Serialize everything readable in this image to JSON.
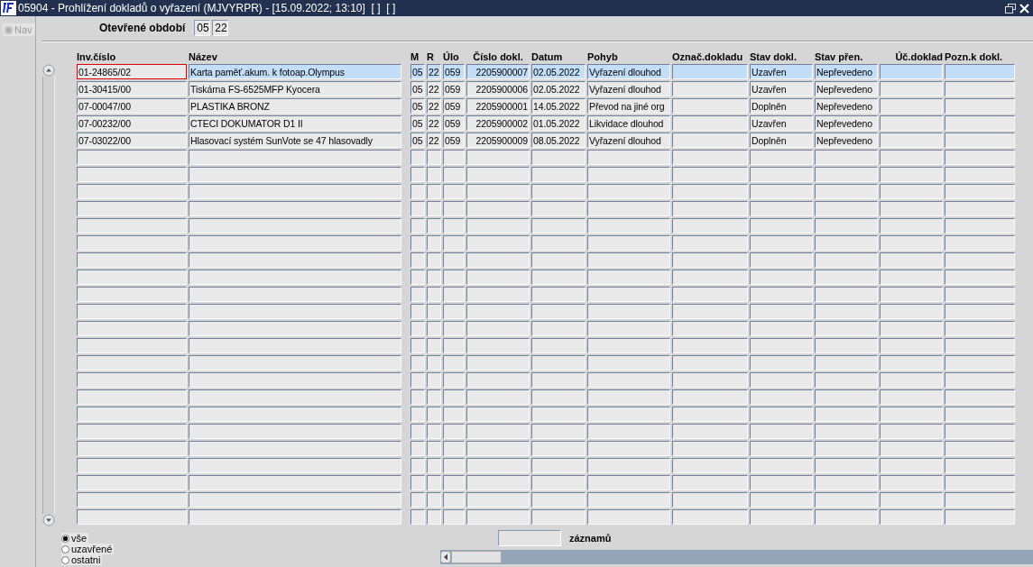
{
  "window": {
    "title": "05904 - Prohlížení dokladů o vyřazení (MJVYRPR) - [15.09.2022; 13:10]  [ ]  [ ]"
  },
  "nav": {
    "label": "Nav",
    "disabled": true
  },
  "period": {
    "label": "Otevřené období",
    "month": "05",
    "year": "22"
  },
  "table": {
    "columns": [
      "Inv.číslo",
      "Název",
      "M",
      "R",
      "Úlo",
      "Číslo dokl.",
      "Datum",
      "Pohyb",
      "Označ.dokladu",
      "Stav dokl.",
      "Stav přen.",
      "Úč.doklad",
      "Pozn.k dokl."
    ],
    "rows": [
      {
        "selected": true,
        "focused": true,
        "cells": [
          "01-24865/02",
          "Karta paměť.akum. k fotoap.Olympus",
          "05",
          "22",
          "059",
          "2205900007",
          "02.05.2022",
          "Vyřazení dlouhod",
          null,
          "Uzavřen",
          "Nepřevedeno",
          null,
          null
        ]
      },
      {
        "selected": false,
        "focused": false,
        "cells": [
          "01-30415/00",
          "Tiskárna FS-6525MFP Kyocera",
          "05",
          "22",
          "059",
          "2205900006",
          "02.05.2022",
          "Vyřazení dlouhod",
          null,
          "Uzavřen",
          "Nepřevedeno",
          null,
          null
        ]
      },
      {
        "selected": false,
        "focused": false,
        "cells": [
          "07-00047/00",
          "PLASTIKA BRONZ",
          "05",
          "22",
          "059",
          "2205900001",
          "14.05.2022",
          "Převod na jiné org",
          null,
          "Doplněn",
          "Nepřevedeno",
          null,
          null
        ]
      },
      {
        "selected": false,
        "focused": false,
        "cells": [
          "07-00232/00",
          "CTECI DOKUMATOR D1 II",
          "05",
          "22",
          "059",
          "2205900002",
          "01.05.2022",
          "Likvidace dlouhod",
          null,
          "Uzavřen",
          "Nepřevedeno",
          null,
          null
        ]
      },
      {
        "selected": false,
        "focused": false,
        "cells": [
          "07-03022/00",
          "Hlasovací systém SunVote se 47 hlasovadly",
          "05",
          "22",
          "059",
          "2205900009",
          "08.05.2022",
          "Vyřazení dlouhod",
          null,
          "Doplněn",
          "Nepřevedeno",
          null,
          null
        ]
      }
    ]
  },
  "filter": [
    {
      "label": "vše",
      "selected": true
    },
    {
      "label": "uzavřené",
      "selected": false
    },
    {
      "label": "ostatni",
      "selected": false
    }
  ],
  "records": {
    "label": "záznamů"
  }
}
